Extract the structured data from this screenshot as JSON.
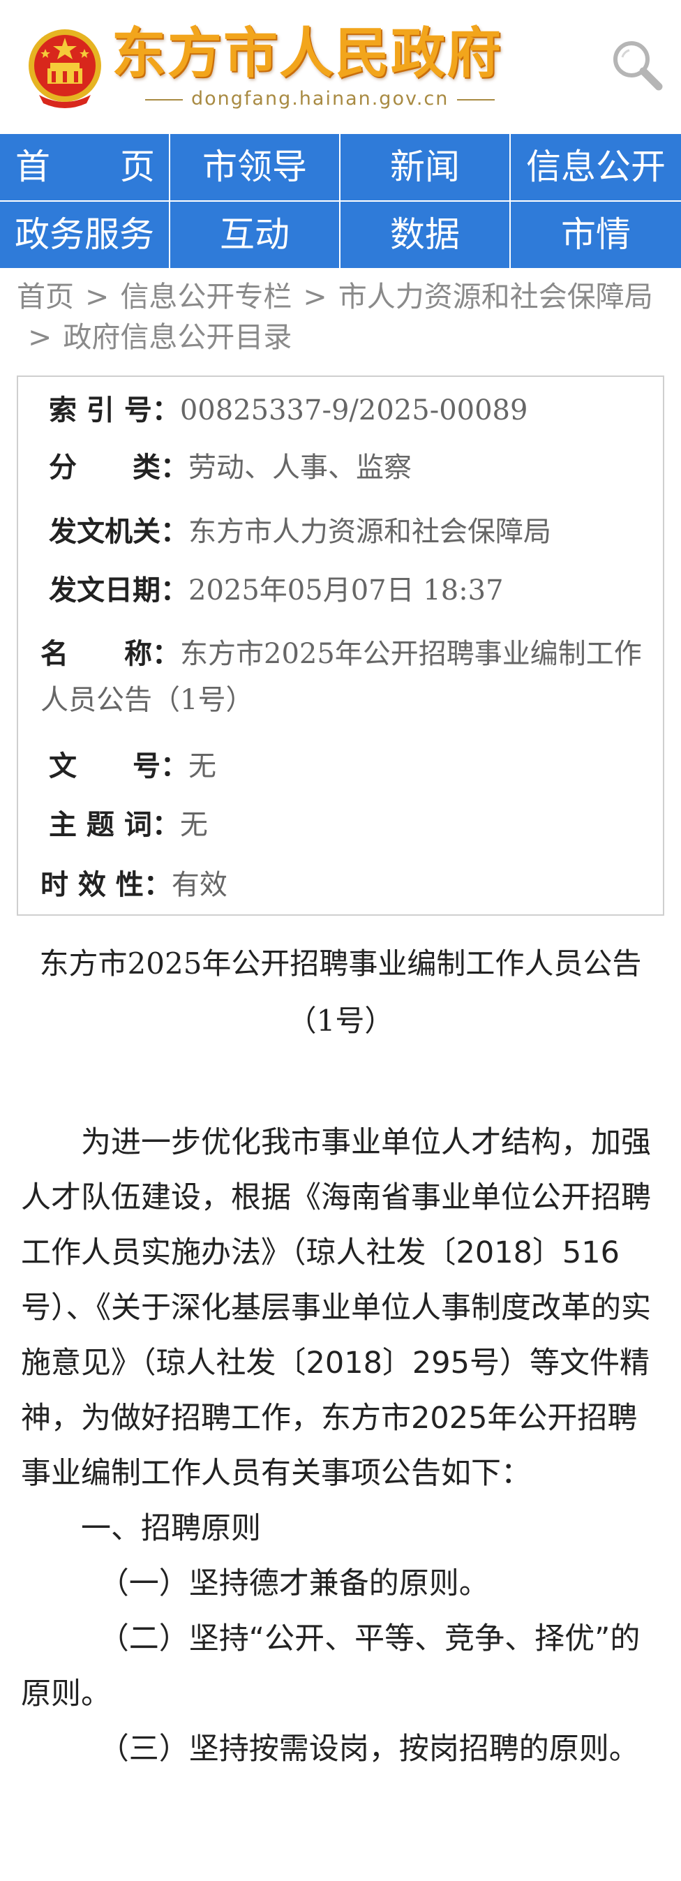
{
  "header": {
    "site_title": "东方市人民政府",
    "domain": "dongfang.hainan.gov.cn",
    "emblem_icon": "national-emblem-icon",
    "search_icon": "search-icon"
  },
  "nav": {
    "items": [
      "首　　页",
      "市领导",
      "新闻",
      "信息公开",
      "政务服务",
      "互动",
      "数据",
      "市情"
    ]
  },
  "breadcrumb": {
    "items": [
      "首页",
      "信息公开专栏",
      "市人力资源和社会保障局",
      "政府信息公开目录"
    ],
    "separator": ">"
  },
  "meta": {
    "index_label": "索 引 号：",
    "index_value": "00825337-9/2025-00089",
    "category_label": "分　　类：",
    "category_value": "劳动、人事、监察",
    "issuer_label": "发文机关：",
    "issuer_value": "东方市人力资源和社会保障局",
    "date_label": "发文日期：",
    "date_value": "2025年05月07日 18:37",
    "name_label": "名　　称：",
    "name_value": "东方市2025年公开招聘事业编制工作人员公告（1号）",
    "docno_label": "文　　号：",
    "docno_value": "无",
    "keywords_label": "主 题 词：",
    "keywords_value": "无",
    "validity_label": "时 效 性：",
    "validity_value": "有效"
  },
  "article": {
    "title": "东方市2025年公开招聘事业编制工作人员公告（1号）",
    "paragraphs": [
      "为进一步优化我市事业单位人才结构，加强人才队伍建设，根据《海南省事业单位公开招聘工作人员实施办法》（琼人社发〔2018〕516号）、《关于深化基层事业单位人事制度改革的实施意见》（琼人社发〔2018〕295号）等文件精神，为做好招聘工作，东方市2025年公开招聘事业编制工作人员有关事项公告如下：",
      "一、招聘原则",
      "（一）坚持德才兼备的原则。",
      "（二）坚持“公开、平等、竞争、择优”的原则。",
      "（三）坚持按需设岗，按岗招聘的原则。"
    ]
  },
  "colors": {
    "nav_bg": "#2f7bd9",
    "title_gold": "#f2a51c",
    "emblem_red": "#d8271c"
  }
}
